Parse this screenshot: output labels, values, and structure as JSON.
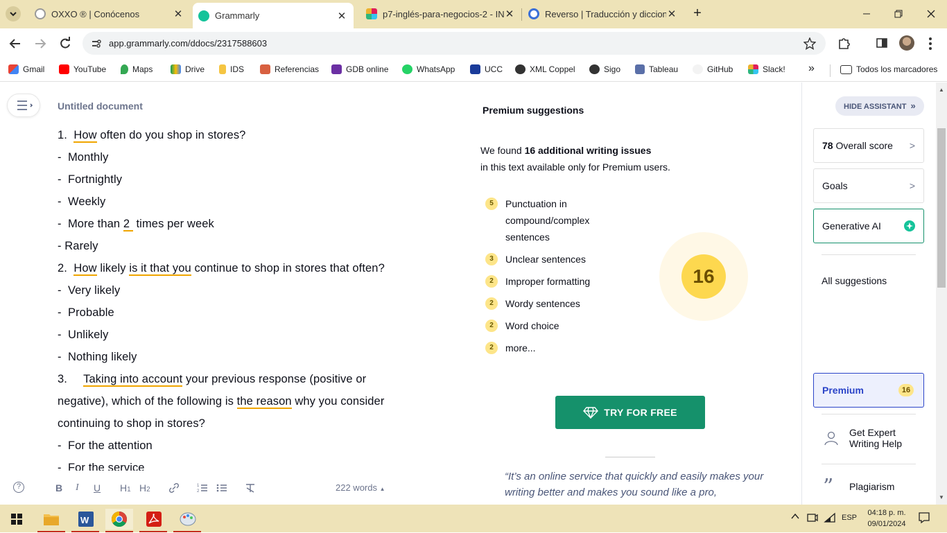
{
  "browser": {
    "tabs": [
      {
        "title": "OXXO ® | Conócenos",
        "icon": "oxxo-icon"
      },
      {
        "title": "Grammarly",
        "icon": "grammarly-icon",
        "active": true
      },
      {
        "title": "p7-inglés-para-negocios-2 - IN",
        "icon": "slack-icon"
      },
      {
        "title": "Reverso | Traducción y dicciona",
        "icon": "reverso-icon"
      }
    ],
    "url": "app.grammarly.com/ddocs/2317588603",
    "bookmarks": [
      "Gmail",
      "YouTube",
      "Maps",
      "Drive",
      "IDS",
      "Referencias",
      "GDB online",
      "WhatsApp",
      "UCC",
      "XML Coppel",
      "Sigo",
      "Tableau",
      "GitHub",
      "Slack!"
    ],
    "all_bookmarks": "Todos los marcadores",
    "overflow": "»"
  },
  "doc": {
    "title": "Untitled document",
    "words": "222 words"
  },
  "premium": {
    "title": "Premium suggestions",
    "found_pre": "We found ",
    "found_bold": "16 additional writing issues",
    "found_post": "in this text available only for Premium users.",
    "items": [
      {
        "count": "5",
        "label": "Punctuation in compound/complex sentences"
      },
      {
        "count": "3",
        "label": "Unclear sentences"
      },
      {
        "count": "2",
        "label": "Improper formatting"
      },
      {
        "count": "2",
        "label": "Wordy sentences"
      },
      {
        "count": "2",
        "label": "Word choice"
      },
      {
        "count": "2",
        "label": "more..."
      }
    ],
    "total": "16",
    "cta": "TRY FOR FREE",
    "quote": "“It’s an online service that quickly and easily makes your writing better and makes you sound like a pro,"
  },
  "sidebar": {
    "hide": "HIDE ASSISTANT",
    "score_num": "78",
    "score_label": "Overall score",
    "goals": "Goals",
    "genai": "Generative AI",
    "all": "All suggestions",
    "premium": "Premium",
    "premium_count": "16",
    "expert": "Get Expert Writing Help",
    "plagiarism": "Plagiarism"
  },
  "taskbar": {
    "time": "04:18 p. m.",
    "date": "09/01/2024",
    "lang": "ESP"
  }
}
